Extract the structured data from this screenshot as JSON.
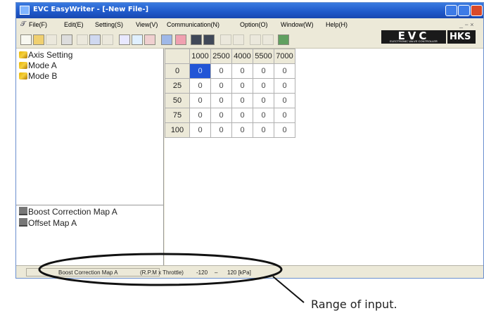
{
  "window": {
    "title": "EVC EasyWriter - [-New File-]"
  },
  "menubar": {
    "items": [
      "File(F)",
      "Edit(E)",
      "Setting(S)",
      "View(V)",
      "Communication(N)",
      "Option(O)",
      "Window(W)",
      "Help(H)"
    ],
    "mdi_controls": "_ − ×"
  },
  "toolbar": {
    "icons": [
      "new-file-icon",
      "open-folder-icon",
      "save-icon",
      "print-icon",
      "cut-icon",
      "copy-icon",
      "paste-icon",
      "tune-icon",
      "graph-icon",
      "chart-icon",
      "car-icon",
      "grid-icon",
      "monitor-icon",
      "upload-icon",
      "blank-icon",
      "blank-icon",
      "blank-icon",
      "blank-icon",
      "chip-icon"
    ]
  },
  "logos": {
    "evc": "EVC",
    "evc_sub": "ELECTRONIC VALVE CONTROLLER",
    "hks": "HKS"
  },
  "tree_top": {
    "items": [
      "Axis Setting",
      "Mode A",
      "Mode B"
    ]
  },
  "tree_bottom": {
    "items": [
      "Boost Correction Map A",
      "Offset Map A"
    ]
  },
  "table": {
    "columns": [
      "1000",
      "2500",
      "4000",
      "5500",
      "7000"
    ],
    "rows": [
      {
        "label": "0",
        "values": [
          "0",
          "0",
          "0",
          "0",
          "0"
        ]
      },
      {
        "label": "25",
        "values": [
          "0",
          "0",
          "0",
          "0",
          "0"
        ]
      },
      {
        "label": "50",
        "values": [
          "0",
          "0",
          "0",
          "0",
          "0"
        ]
      },
      {
        "label": "75",
        "values": [
          "0",
          "0",
          "0",
          "0",
          "0"
        ]
      },
      {
        "label": "100",
        "values": [
          "0",
          "0",
          "0",
          "0",
          "0"
        ]
      }
    ],
    "selected": {
      "row": 0,
      "col": 0
    }
  },
  "statusbar": {
    "map_name": "Boost Correction Map A",
    "axes": "(R.P.M x Throttle)",
    "min": "-120",
    "dash": "–",
    "max": "120 [kPa]"
  },
  "annotation": {
    "text": "Range of input."
  },
  "colors": {
    "titlebar": "#1f58c9",
    "selected_cell": "#2255d6",
    "window_bg": "#ece9d8"
  }
}
